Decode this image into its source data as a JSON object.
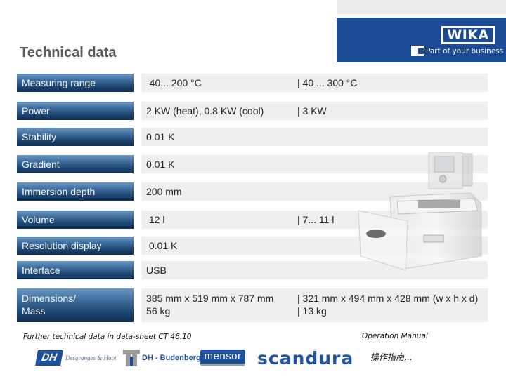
{
  "header": {
    "brand": "WIKA",
    "tagline": "Part of your business",
    "title": "Technical data"
  },
  "rows": [
    {
      "label": "Measuring range",
      "v1": "-40... 200 °C",
      "v2": "| 40 ... 300 °C"
    },
    {
      "label": "Power",
      "v1": "2 KW (heat), 0.8 KW (cool)",
      "v2": "| 3 KW"
    },
    {
      "label": "Stability",
      "v1": "0.01 K",
      "v2": ""
    },
    {
      "label": "Gradient",
      "v1": "0.01 K",
      "v2": ""
    },
    {
      "label": "Immersion depth",
      "v1": "200 mm",
      "v2": ""
    },
    {
      "label": "Volume",
      "v1": " 12 l",
      "v2": "| 7... 11 l"
    },
    {
      "label": "Resolution display",
      "v1": " 0.01 K",
      "v2": ""
    },
    {
      "label": "Interface",
      "v1": "USB",
      "v2": ""
    },
    {
      "label_line1": "Dimensions/",
      "label_line2": "Mass",
      "v1_line1": "385 mm x 519 mm x 787 mm",
      "v1_line2": "56 kg",
      "v2_line1": "| 321 mm x 494 mm x 428 mm (w x h x d)",
      "v2_line2": "| 13 kg"
    }
  ],
  "footer": {
    "note": "Further technical data in data-sheet CT 46.10",
    "operation_manual": "Operation Manual",
    "operation_manual_cn": "操作指南…",
    "logos": {
      "dh_mark": "DH",
      "dh_text": "Desgranges & Huot",
      "budenberg_text": "DH - Budenberg",
      "mensor": "mensor",
      "scandura": "scandura"
    }
  },
  "colors": {
    "brand_blue": "#1b4a97",
    "label_gradient_top": "#6b97c3",
    "label_gradient_bottom": "#0e2e52",
    "value_bg": "#efefef"
  }
}
